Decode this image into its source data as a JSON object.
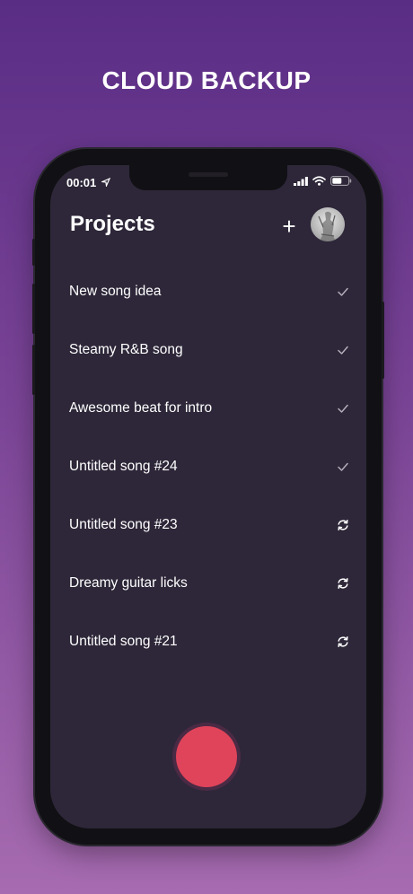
{
  "headline": "CLOUD BACKUP",
  "status_bar": {
    "time": "00:01"
  },
  "header": {
    "title": "Projects",
    "add_label": "+"
  },
  "projects": [
    {
      "name": "New song idea",
      "status": "synced"
    },
    {
      "name": "Steamy R&B song",
      "status": "synced"
    },
    {
      "name": "Awesome beat for intro",
      "status": "synced"
    },
    {
      "name": "Untitled song #24",
      "status": "synced"
    },
    {
      "name": "Untitled song #23",
      "status": "syncing"
    },
    {
      "name": "Dreamy guitar licks",
      "status": "syncing"
    },
    {
      "name": "Untitled song #21",
      "status": "syncing"
    }
  ],
  "colors": {
    "record": "#e0445a",
    "screen": "#2e2739"
  }
}
